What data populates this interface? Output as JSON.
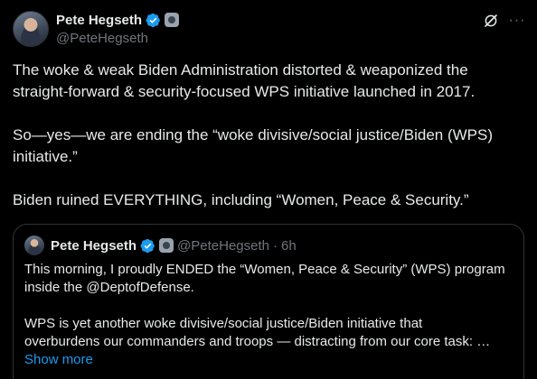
{
  "post": {
    "author": {
      "name": "Pete Hegseth",
      "handle": "@PeteHegseth",
      "avatar_icon": "profile-photo",
      "verified_icon": "verified-badge-icon",
      "affiliation_icon": "government-badge-icon"
    },
    "actions": {
      "grok_icon": "grok-icon",
      "more_icon": "more-options-icon"
    },
    "text": {
      "line1": "The woke & weak Biden Administration distorted & weaponized the",
      "line2": "straight-forward & security-focused WPS initiative launched in 2017.",
      "line3": "So—yes—we are ending the “woke divisive/social justice/Biden (WPS)",
      "line4": "initiative.”",
      "line5": "Biden ruined EVERYTHING, including “Women, Peace & Security.”"
    }
  },
  "quoted_post": {
    "author": {
      "name": "Pete Hegseth",
      "handle": "@PeteHegseth",
      "separator": "·",
      "time": "6h"
    },
    "text": {
      "line1": "This morning, I proudly ENDED the “Women, Peace & Security” (WPS) program",
      "line2": "inside the @DeptofDefense.",
      "line3": "WPS is yet another woke divisive/social justice/Biden initiative that",
      "line4": "overburdens our commanders and troops — distracting from our core task: …"
    },
    "show_more_label": "Show more"
  },
  "colors": {
    "background": "#000000",
    "text_primary": "#e7e9ea",
    "text_secondary": "#71767b",
    "link": "#1d9bf0",
    "border": "#2f3336",
    "verified": "#1d9bf0"
  }
}
